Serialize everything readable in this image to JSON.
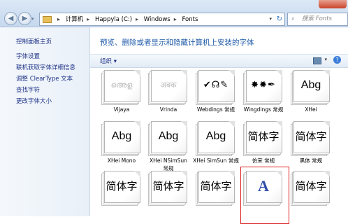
{
  "window": {
    "back_arrow": "◀",
    "forward_arrow": "▶",
    "recent_arrow": "▾",
    "breadcrumbs": [
      "计算机",
      "Happyla (C:)",
      "Windows",
      "Fonts"
    ],
    "breadcrumb_sep": "▸",
    "address_dropdown": "▾",
    "refresh_glyph": "↻",
    "search_placeholder": "搜索 Fonts",
    "search_glyph": "⌕"
  },
  "nav": {
    "items": [
      "控制面板主页",
      "字体设置",
      "联机获取字体详细信息",
      "调整 ClearType 文本",
      "查找字符",
      "更改字体大小"
    ]
  },
  "main": {
    "heading": "预览、删除或者显示和隐藏计算机上安装的字体",
    "organize_label": "组织 ▾",
    "view_dropdown": "▾",
    "help_glyph": "?"
  },
  "fonts": [
    {
      "sample": "അെള",
      "name": "Vijaya",
      "style": "faded"
    },
    {
      "sample": "अबक",
      "name": "Vrinda",
      "style": "faded"
    },
    {
      "sample": "✔☊✎",
      "name": "Webdings 常规",
      "style": "sym"
    },
    {
      "sample": "✸✹✒",
      "name": "Wingdings 常规",
      "style": "sym"
    },
    {
      "sample": "Abg",
      "name": "XHei",
      "style": "latin"
    },
    {
      "sample": "Abg",
      "name": "XHei Mono",
      "style": "latin"
    },
    {
      "sample": "Abg",
      "name": "XHei NSimSun",
      "name2": "常规",
      "style": "latin"
    },
    {
      "sample": "Abg",
      "name": "XHei SimSun 常规",
      "style": "latin"
    },
    {
      "sample": "简体字",
      "name": "仿宋 常规",
      "style": "cjk"
    },
    {
      "sample": "简体字",
      "name": "黑体 常规",
      "style": "cjk"
    },
    {
      "sample": "简体字",
      "name": "",
      "style": "cjk"
    },
    {
      "sample": "简体字",
      "name": "",
      "style": "cjk"
    },
    {
      "sample": "简体字",
      "name": "",
      "style": "cjk"
    },
    {
      "sample": "A",
      "name": "",
      "style": "serifA"
    },
    {
      "sample": "简体字",
      "name": "",
      "style": "cjk"
    }
  ]
}
